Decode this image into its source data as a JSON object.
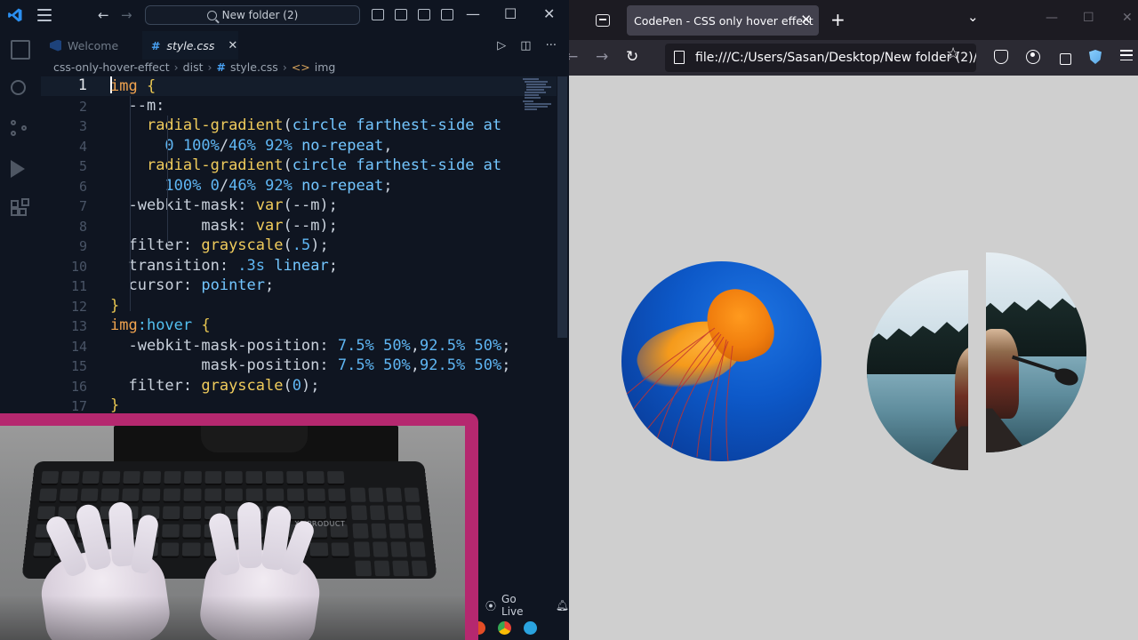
{
  "vscode": {
    "command_center": "New folder (2)",
    "tabs": [
      {
        "label": "Welcome",
        "active": false
      },
      {
        "label": "style.css",
        "active": true
      }
    ],
    "breadcrumb": [
      "css-only-hover-effect",
      "dist",
      "style.css",
      "img"
    ],
    "lines": [
      {
        "num": "1",
        "text": "img {"
      },
      {
        "num": "2",
        "text": "  --m:"
      },
      {
        "num": "3",
        "text": "    radial-gradient(circle farthest-side at"
      },
      {
        "num": "4",
        "text": "      0 100%/46% 92% no-repeat,"
      },
      {
        "num": "5",
        "text": "    radial-gradient(circle farthest-side at"
      },
      {
        "num": "6",
        "text": "      100% 0/46% 92% no-repeat;"
      },
      {
        "num": "7",
        "text": "  -webkit-mask: var(--m);"
      },
      {
        "num": "8",
        "text": "          mask: var(--m);"
      },
      {
        "num": "9",
        "text": "  filter: grayscale(.5);"
      },
      {
        "num": "10",
        "text": "  transition: .3s linear;"
      },
      {
        "num": "11",
        "text": "  cursor: pointer;"
      },
      {
        "num": "12",
        "text": "}"
      },
      {
        "num": "13",
        "text": "img:hover {"
      },
      {
        "num": "14",
        "text": "  -webkit-mask-position: 7.5% 50%,92.5% 50%;"
      },
      {
        "num": "15",
        "text": "          mask-position: 7.5% 50%,92.5% 50%;"
      },
      {
        "num": "16",
        "text": "  filter: grayscale(0);"
      },
      {
        "num": "17",
        "text": "}"
      }
    ],
    "status": {
      "go_live": "Go Live"
    },
    "webcam": {
      "keyboard_brand": "XP PRODUCT"
    }
  },
  "browser": {
    "tab_title": "CodePen - CSS only hover effect",
    "url": "file:///C:/Users/Sasan/Desktop/New folder (2)/",
    "page_bg": "#cfcfcf"
  },
  "colors": {
    "vscode_bg": "#0f1521",
    "pip_border": "#b5286f",
    "accent_blue": "#4aa3f5"
  }
}
